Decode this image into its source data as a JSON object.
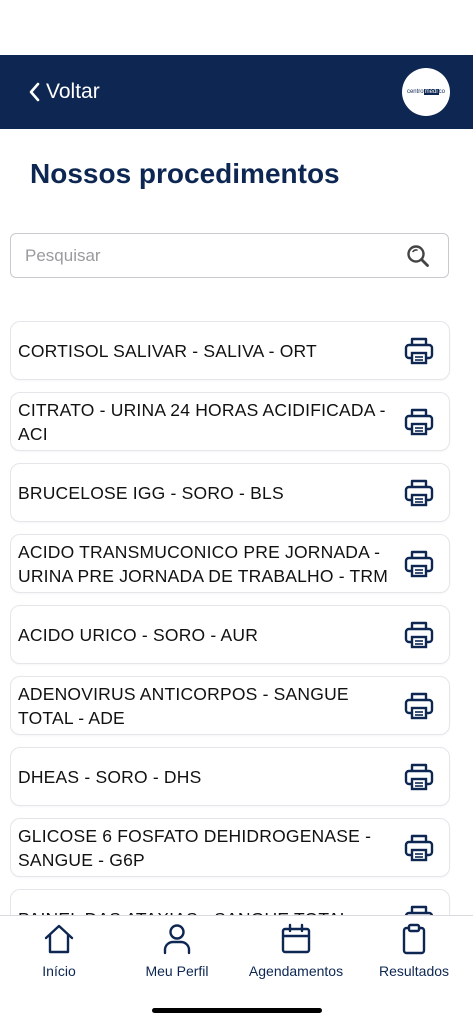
{
  "header": {
    "back_label": "Voltar",
    "logo": {
      "text_pre": "centro",
      "text_hl": "médi",
      "text_post": "co"
    }
  },
  "page_title": "Nossos procedimentos",
  "search": {
    "placeholder": "Pesquisar",
    "value": ""
  },
  "procedures": [
    {
      "label": "CORTISOL SALIVAR - SALIVA - ORT"
    },
    {
      "label": "CITRATO - URINA 24 HORAS ACIDIFICADA - ACI"
    },
    {
      "label": "BRUCELOSE IGG - SORO - BLS"
    },
    {
      "label": "ACIDO TRANSMUCONICO PRE JORNADA - URINA PRE JORNADA DE TRABALHO - TRM"
    },
    {
      "label": "ACIDO URICO - SORO - AUR"
    },
    {
      "label": "ADENOVIRUS ANTICORPOS - SANGUE TOTAL - ADE"
    },
    {
      "label": "DHEAS - SORO - DHS"
    },
    {
      "label": "GLICOSE 6 FOSFATO DEHIDROGENASE - SANGUE - G6P"
    },
    {
      "label": "PAINEL DAS ATAXIAS - SANGUE TOTAL -"
    }
  ],
  "tabbar": {
    "items": [
      {
        "label": "Início",
        "icon": "home-icon"
      },
      {
        "label": "Meu Perfil",
        "icon": "user-icon"
      },
      {
        "label": "Agendamentos",
        "icon": "calendar-icon"
      },
      {
        "label": "Resultados",
        "icon": "clipboard-icon"
      }
    ]
  },
  "colors": {
    "brand": "#0d2752",
    "background": "#ffffff",
    "border": "#e6e6ea"
  }
}
